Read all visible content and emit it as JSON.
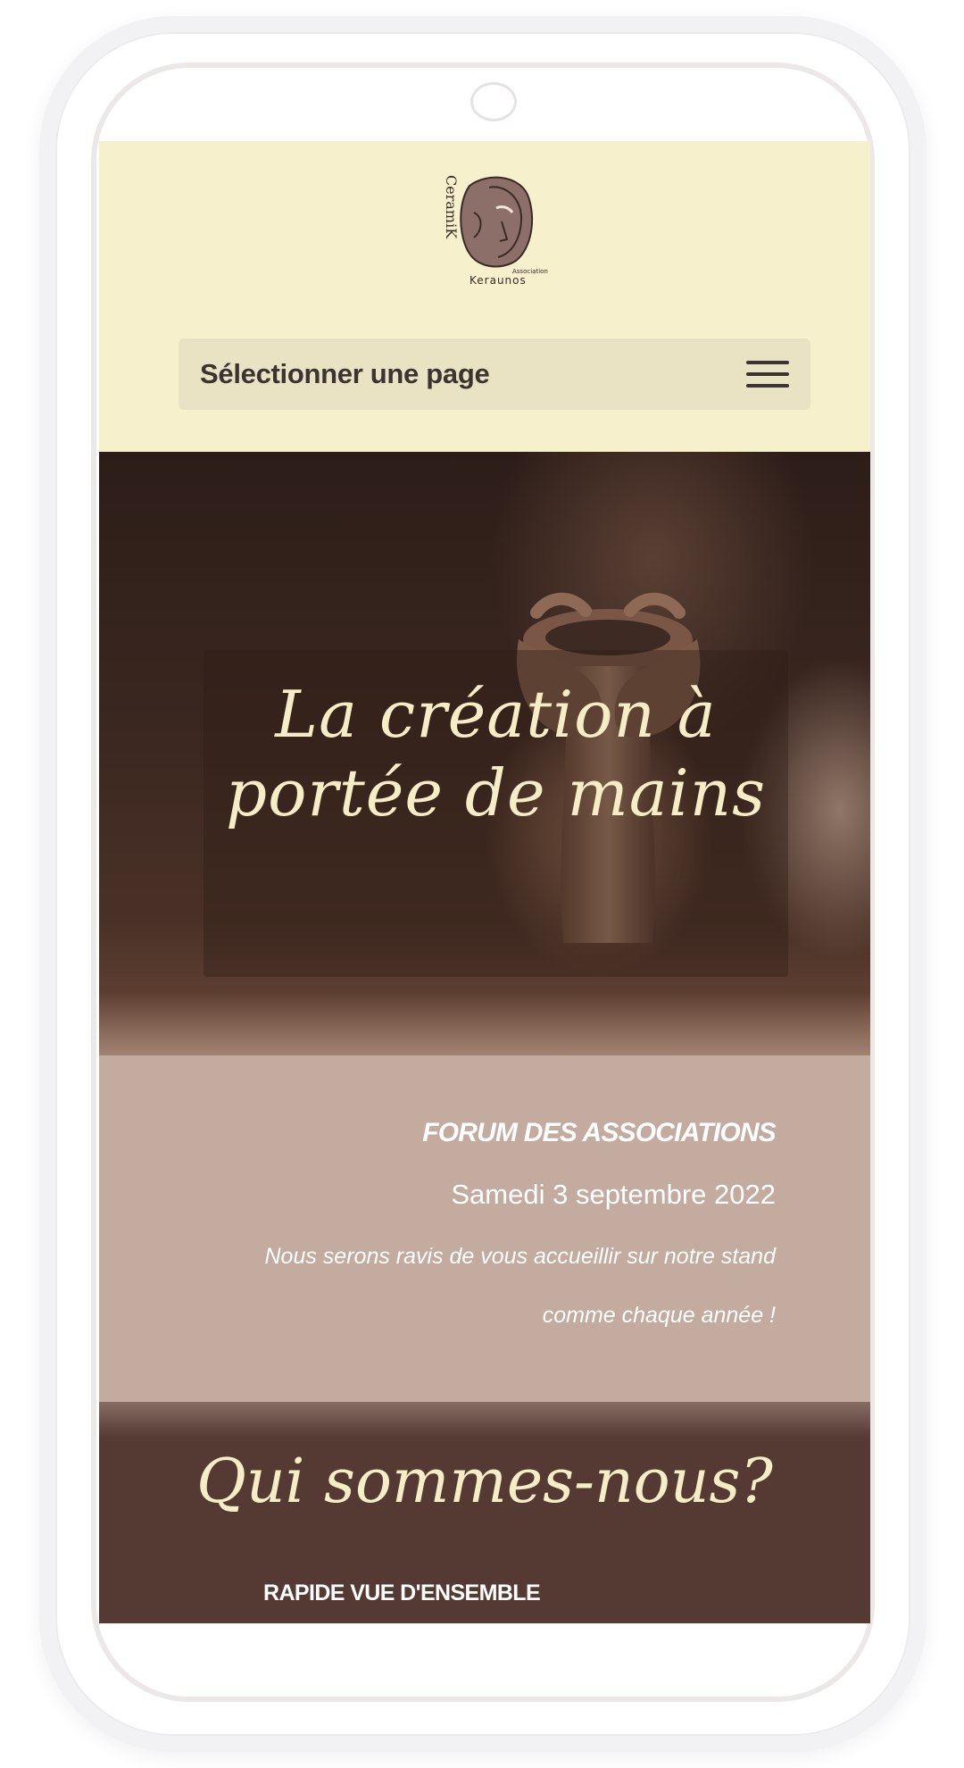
{
  "header": {
    "logo_text": "CeramiK",
    "logo_small_text": "Association",
    "logo_sub_text": "Keraunos",
    "menu_label": "Sélectionner une page"
  },
  "hero": {
    "title_line1": "La création à",
    "title_line2": "portée de mains"
  },
  "forum": {
    "title": "FORUM DES ASSOCIATIONS",
    "date": "Samedi 3 septembre 2022",
    "description": "Nous serons ravis de vous accueillir sur notre stand comme chaque année !"
  },
  "about": {
    "title": "Qui sommes-nous?",
    "subtitle": "RAPIDE VUE D'ENSEMBLE"
  },
  "colors": {
    "header_bg": "#f7f0cc",
    "menu_bg": "#e9e2c3",
    "forum_bg": "#c3ab9f",
    "about_bg": "#553a34",
    "script_text": "#f6edc6"
  }
}
